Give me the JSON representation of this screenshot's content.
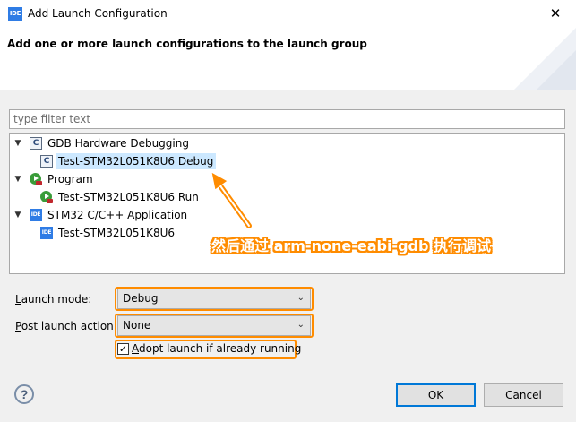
{
  "window": {
    "app_icon": "IDE",
    "title": "Add Launch Configuration",
    "close_icon": "✕"
  },
  "header": {
    "text": "Add one or more launch configurations to the launch group"
  },
  "filter": {
    "placeholder": "type filter text"
  },
  "tree": {
    "items": [
      {
        "label": "GDB Hardware Debugging",
        "icon": "c-config-icon",
        "icon_text": "C",
        "expanded": true
      },
      {
        "label": "Test-STM32L051K8U6 Debug",
        "icon": "c-config-icon",
        "icon_text": "C",
        "selected": true
      },
      {
        "label": "Program",
        "icon": "run-program-icon",
        "expanded": true
      },
      {
        "label": "Test-STM32L051K8U6 Run",
        "icon": "run-program-icon"
      },
      {
        "label": "STM32 C/C++ Application",
        "icon": "ide-icon",
        "icon_text": "IDE",
        "expanded": true
      },
      {
        "label": "Test-STM32L051K8U6",
        "icon": "ide-icon",
        "icon_text": "IDE"
      }
    ]
  },
  "annotation": {
    "text": "然后通过 arm-none-eabi-gdb 执行调试",
    "color": "#ff8c00"
  },
  "launch_mode": {
    "label_prefix": "",
    "label_mnemonic": "L",
    "label_rest": "aunch mode:",
    "value": "Debug"
  },
  "post_launch": {
    "label_mnemonic": "P",
    "label_rest": "ost launch action:",
    "value": "None"
  },
  "adopt": {
    "checked": true,
    "label_mnemonic": "A",
    "label_rest": "dopt launch if already running"
  },
  "buttons": {
    "help": "?",
    "ok": "OK",
    "cancel": "Cancel"
  }
}
